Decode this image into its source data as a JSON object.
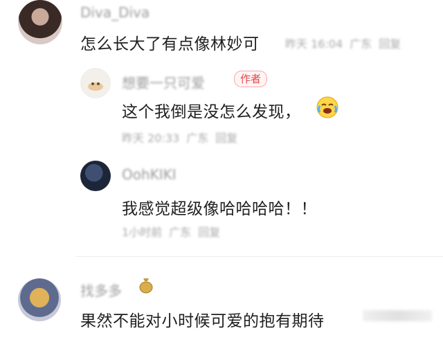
{
  "comments": [
    {
      "username": "Diva_Diva",
      "text": "怎么长大了有点像林妙可",
      "meta": {
        "time": "昨天 16:04",
        "location": "广东",
        "reply_label": "回复"
      }
    },
    {
      "username": "想要一只可爱",
      "author_badge": "作者",
      "text": "这个我倒是没怎么发现，",
      "emoji": "crying-laughing-emoji",
      "meta": {
        "time": "昨天 20:33",
        "location": "广东",
        "reply_label": "回复"
      }
    },
    {
      "username": "OohKIKI",
      "text": "我感觉超级像哈哈哈哈！！",
      "meta": {
        "time": "1小时前",
        "location": "广东",
        "reply_label": "回复"
      }
    },
    {
      "username": "找多多",
      "text": "果然不能对小时候可爱的抱有期待",
      "meta": {
        "time": "",
        "location": "",
        "reply_label": ""
      }
    }
  ],
  "colors": {
    "author_badge": "#e04848",
    "username": "#9a9a9a",
    "meta": "#a8a8a8",
    "text": "#1f1f1f"
  }
}
